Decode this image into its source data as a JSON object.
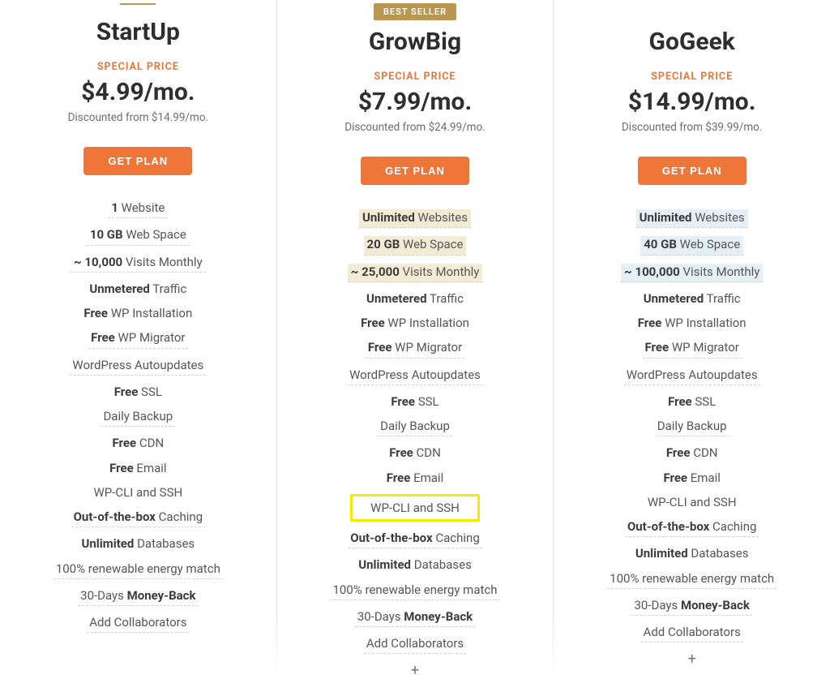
{
  "labels": {
    "special": "SPECIAL PRICE",
    "cta": "GET PLAN",
    "best_seller": "BEST SELLER",
    "plus": "+"
  },
  "plans": [
    {
      "name": "StartUp",
      "price": "$4.99/mo.",
      "discount": "Discounted from $14.99/mo."
    },
    {
      "name": "GrowBig",
      "price": "$7.99/mo.",
      "discount": "Discounted from $24.99/mo."
    },
    {
      "name": "GoGeek",
      "price": "$14.99/mo.",
      "discount": "Discounted from $39.99/mo."
    }
  ],
  "feature_text": {
    "websites_1": {
      "b": "1",
      "r": " Website"
    },
    "websites_unl": {
      "b": "Unlimited",
      "r": " Websites"
    },
    "web10": {
      "b": "10 GB",
      "r": " Web Space"
    },
    "web20": {
      "b": "20 GB",
      "r": " Web Space"
    },
    "web40": {
      "b": "40 GB",
      "r": " Web Space"
    },
    "vis10": {
      "b": "~ 10,000",
      "r": " Visits Monthly"
    },
    "vis25": {
      "b": "~ 25,000",
      "r": " Visits Monthly"
    },
    "vis100": {
      "b": "~ 100,000",
      "r": " Visits Monthly"
    },
    "traffic": {
      "b": "Unmetered",
      "r": " Traffic"
    },
    "wp_install": {
      "b": "Free",
      "r": " WP Installation"
    },
    "wp_migrator": {
      "b": "Free",
      "r": " WP Migrator"
    },
    "autoupdates": "WordPress Autoupdates",
    "ssl": {
      "b": "Free",
      "r": " SSL"
    },
    "daily_backup": "Daily Backup",
    "cdn": {
      "b": "Free",
      "r": " CDN"
    },
    "email": {
      "b": "Free",
      "r": " Email"
    },
    "wpcli": "WP-CLI and SSH",
    "caching": {
      "b": "Out-of-the-box",
      "r": " Caching"
    },
    "databases": {
      "b": "Unlimited",
      "r": " Databases"
    },
    "renewable": "100% renewable energy match",
    "moneyback": {
      "l": "30-Days ",
      "b": "Money-Back"
    },
    "collab": "Add Collaborators"
  }
}
